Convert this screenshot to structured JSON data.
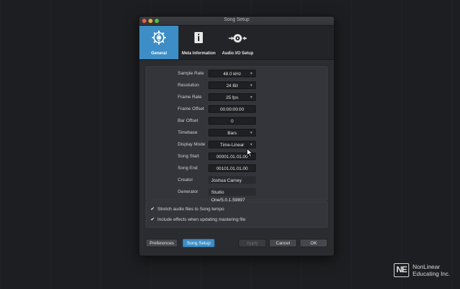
{
  "window": {
    "title": "Song Setup"
  },
  "tabs": [
    {
      "label": "General",
      "icon": "gear-icon",
      "active": true
    },
    {
      "label": "Meta Information",
      "icon": "info-icon",
      "active": false
    },
    {
      "label": "Audio I/O Setup",
      "icon": "audio-io-icon",
      "active": false
    }
  ],
  "settings": {
    "sample_rate": {
      "label": "Sample Rate",
      "value": "48.0 kHz"
    },
    "resolution": {
      "label": "Resolution",
      "value": "24 Bit"
    },
    "frame_rate": {
      "label": "Frame Rate",
      "value": "25 fps"
    },
    "frame_offset": {
      "label": "Frame Offset",
      "value": "00:00:00:00"
    },
    "bar_offset": {
      "label": "Bar Offset",
      "value": "0"
    },
    "timebase": {
      "label": "Timebase",
      "value": "Bars"
    },
    "display_mode": {
      "label": "Display Mode",
      "value": "Time-Linear"
    },
    "song_start": {
      "label": "Song Start",
      "value": "00001.01.01.00"
    },
    "song_end": {
      "label": "Song End",
      "value": "00101.01.01.00"
    },
    "creator": {
      "label": "Creator",
      "value": "Joshua Carney"
    },
    "generator": {
      "label": "Generator",
      "value": "Studio One/5.0.1.59897"
    }
  },
  "options": {
    "stretch_audio": {
      "label": "Stretch audio files to Song tempo",
      "checked": true
    },
    "include_effects": {
      "label": "Include effects when updating mastering file",
      "checked": true
    }
  },
  "buttons": {
    "preferences": "Preferences",
    "song_setup": "Song Setup",
    "apply": "Apply",
    "cancel": "Cancel",
    "ok": "OK"
  },
  "branding": {
    "line1": "NonLinear",
    "line2": "Educating Inc.",
    "monogram": "NE"
  },
  "colors": {
    "accent": "#3d8ec6",
    "background": "#1d1e21",
    "dialog": "#2b2c30"
  }
}
